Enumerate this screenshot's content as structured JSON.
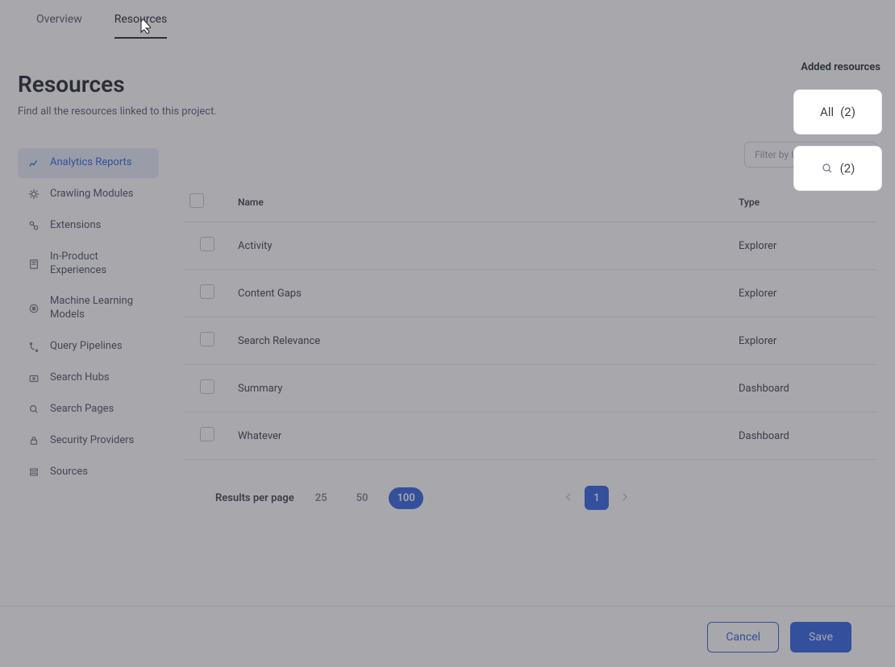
{
  "tabs": [
    {
      "label": "Overview",
      "active": false
    },
    {
      "label": "Resources",
      "active": true
    }
  ],
  "headline": {
    "title": "Resources",
    "subtitle": "Find all the resources linked to this project."
  },
  "sidebar": {
    "items": [
      {
        "label": "Analytics Reports",
        "icon": "chart-line-icon",
        "selected": true
      },
      {
        "label": "Crawling Modules",
        "icon": "crawl-icon",
        "selected": false
      },
      {
        "label": "Extensions",
        "icon": "extensions-icon",
        "selected": false
      },
      {
        "label": "In-Product Experiences",
        "icon": "doc-icon",
        "selected": false
      },
      {
        "label": "Machine Learning Models",
        "icon": "ml-icon",
        "selected": false
      },
      {
        "label": "Query Pipelines",
        "icon": "pipeline-icon",
        "selected": false
      },
      {
        "label": "Search Hubs",
        "icon": "hub-icon",
        "selected": false
      },
      {
        "label": "Search Pages",
        "icon": "search-icon",
        "selected": false
      },
      {
        "label": "Security Providers",
        "icon": "lock-icon",
        "selected": false
      },
      {
        "label": "Sources",
        "icon": "sources-icon",
        "selected": false
      }
    ]
  },
  "filter": {
    "placeholder": "Filter by ID or name"
  },
  "table": {
    "columns": {
      "name": "Name",
      "type": "Type"
    },
    "rows": [
      {
        "name": "Activity",
        "type": "Explorer"
      },
      {
        "name": "Content Gaps",
        "type": "Explorer"
      },
      {
        "name": "Search Relevance",
        "type": "Explorer"
      },
      {
        "name": "Summary",
        "type": "Dashboard"
      },
      {
        "name": "Whatever",
        "type": "Dashboard"
      }
    ]
  },
  "pager": {
    "label": "Results per page",
    "options": [
      {
        "value": "25",
        "active": false
      },
      {
        "value": "50",
        "active": false
      },
      {
        "value": "100",
        "active": true
      }
    ],
    "current_page": "1"
  },
  "added": {
    "title": "Added resources",
    "cards": [
      {
        "prefix": "All",
        "count": "(2)",
        "icon": null
      },
      {
        "prefix": "",
        "count": "(2)",
        "icon": "search-icon"
      }
    ]
  },
  "footer": {
    "cancel": "Cancel",
    "save": "Save"
  }
}
